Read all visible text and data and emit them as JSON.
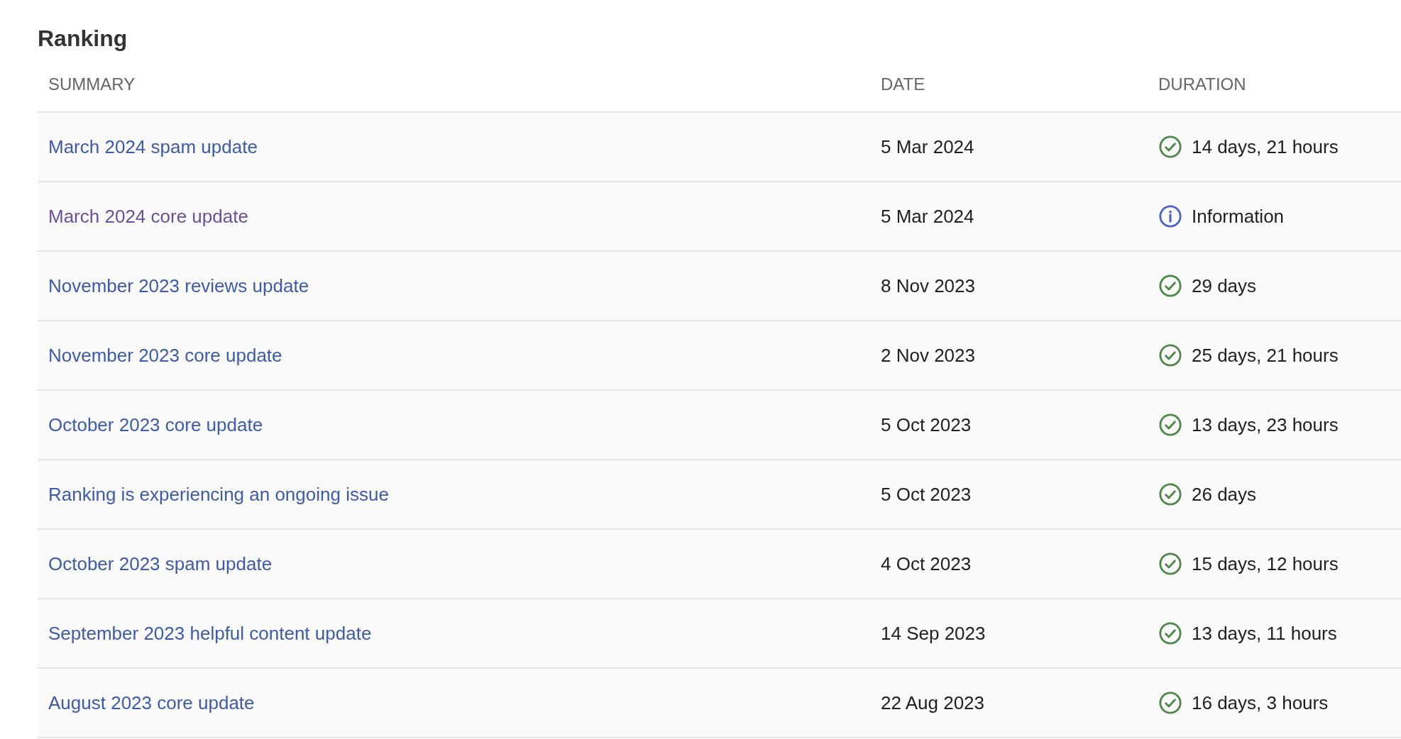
{
  "title": "Ranking",
  "table": {
    "columns": [
      "SUMMARY",
      "DATE",
      "DURATION"
    ],
    "rows": [
      {
        "summary": "March 2024 spam update",
        "visited": false,
        "date": "5 Mar 2024",
        "kind": "check",
        "duration": "14 days, 21 hours"
      },
      {
        "summary": "March 2024 core update",
        "visited": true,
        "date": "5 Mar 2024",
        "kind": "info",
        "duration": "Information"
      },
      {
        "summary": "November 2023 reviews update",
        "visited": false,
        "date": "8 Nov 2023",
        "kind": "check",
        "duration": "29 days"
      },
      {
        "summary": "November 2023 core update",
        "visited": false,
        "date": "2 Nov 2023",
        "kind": "check",
        "duration": "25 days, 21 hours"
      },
      {
        "summary": "October 2023 core update",
        "visited": false,
        "date": "5 Oct 2023",
        "kind": "check",
        "duration": "13 days, 23 hours"
      },
      {
        "summary": "Ranking is experiencing an ongoing issue",
        "visited": false,
        "date": "5 Oct 2023",
        "kind": "check",
        "duration": "26 days"
      },
      {
        "summary": "October 2023 spam update",
        "visited": false,
        "date": "4 Oct 2023",
        "kind": "check",
        "duration": "15 days, 12 hours"
      },
      {
        "summary": "September 2023 helpful content update",
        "visited": false,
        "date": "14 Sep 2023",
        "kind": "check",
        "duration": "13 days, 11 hours"
      },
      {
        "summary": "August 2023 core update",
        "visited": false,
        "date": "22 Aug 2023",
        "kind": "check",
        "duration": "16 days, 3 hours"
      }
    ]
  }
}
